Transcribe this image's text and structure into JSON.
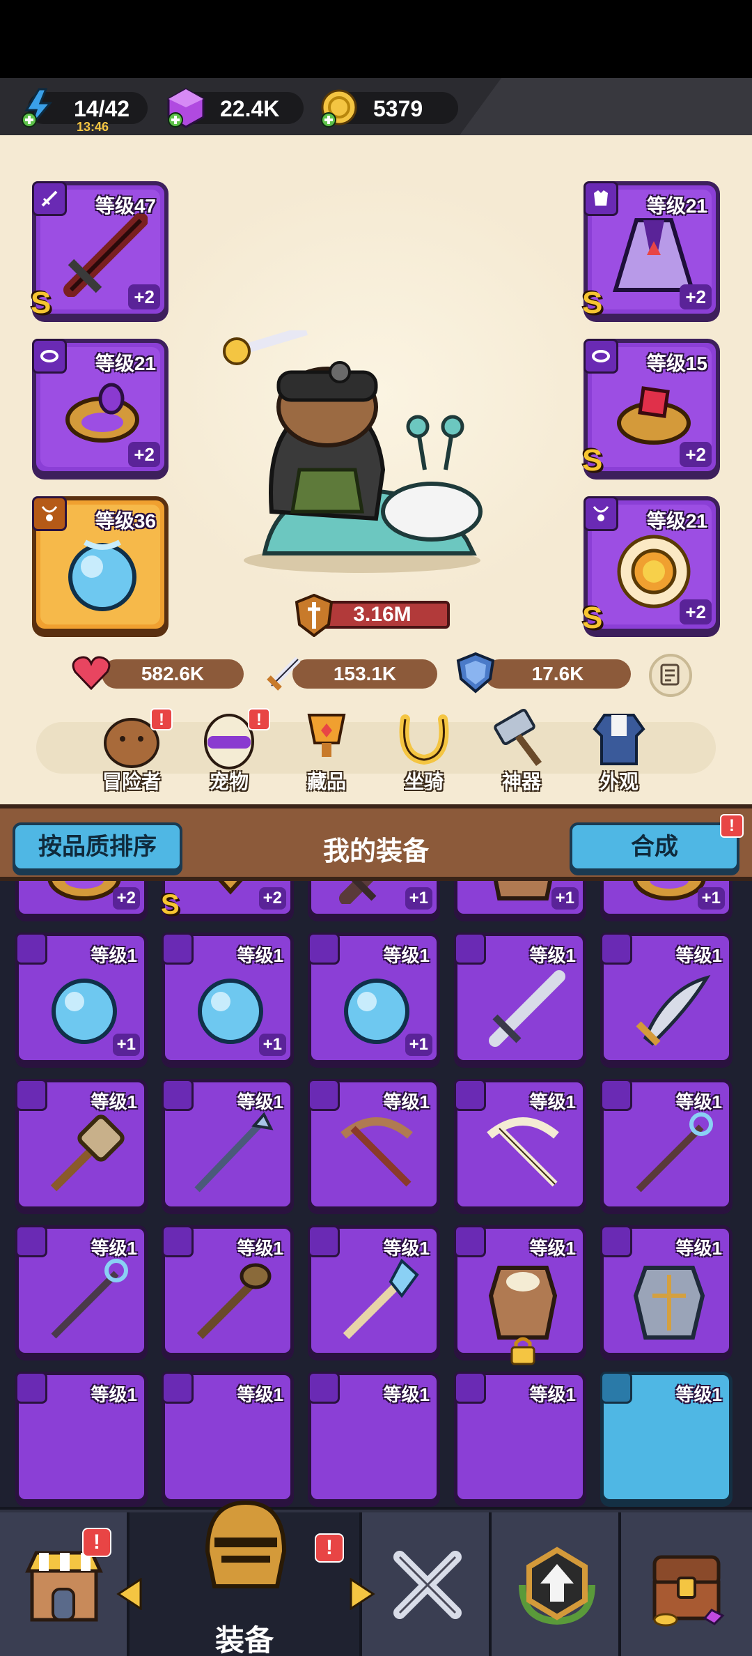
{
  "resources": {
    "energy": {
      "value": "14/42",
      "timer": "13:46",
      "icon": "lightning-icon"
    },
    "gems": {
      "value": "22.4K",
      "icon": "purple-gem-icon"
    },
    "gold": {
      "value": "5379",
      "icon": "gold-coin-icon"
    }
  },
  "hero": {
    "power": "3.16M",
    "stats": {
      "hp": "582.6K",
      "attack": "153.1K",
      "defense": "17.6K"
    }
  },
  "equipped": {
    "weapon": {
      "level": "等级47",
      "plus": "+2",
      "grade": "S"
    },
    "ring_left": {
      "level": "等级21",
      "plus": "+2"
    },
    "necklace": {
      "level": "等级36"
    },
    "armor": {
      "level": "等级21",
      "plus": "+2",
      "grade": "S"
    },
    "ring_right": {
      "level": "等级15",
      "plus": "+2",
      "grade": "S"
    },
    "amulet": {
      "level": "等级21",
      "plus": "+2",
      "grade": "S"
    }
  },
  "tabs": [
    {
      "label": "冒险者",
      "alert": "!"
    },
    {
      "label": "宠物",
      "alert": "!"
    },
    {
      "label": "藏品"
    },
    {
      "label": "坐骑"
    },
    {
      "label": "神器"
    },
    {
      "label": "外观"
    }
  ],
  "equipment_header": {
    "sort_button": "按品质排序",
    "title": "我的装备",
    "merge_button": "合成",
    "merge_alert": "!"
  },
  "inventory": {
    "row0": [
      {
        "plus": "+2"
      },
      {
        "plus": "+2",
        "grade": "S"
      },
      {
        "plus": "+1"
      },
      {
        "plus": "+1"
      },
      {
        "plus": "+1"
      }
    ],
    "row1": [
      {
        "level": "等级1",
        "plus": "+1"
      },
      {
        "level": "等级1",
        "plus": "+1"
      },
      {
        "level": "等级1",
        "plus": "+1"
      },
      {
        "level": "等级1"
      },
      {
        "level": "等级1"
      }
    ],
    "row2": [
      {
        "level": "等级1"
      },
      {
        "level": "等级1"
      },
      {
        "level": "等级1"
      },
      {
        "level": "等级1"
      },
      {
        "level": "等级1"
      }
    ],
    "row3": [
      {
        "level": "等级1"
      },
      {
        "level": "等级1"
      },
      {
        "level": "等级1"
      },
      {
        "level": "等级1"
      },
      {
        "level": "等级1"
      }
    ],
    "row4": [
      {
        "level": "等级1"
      },
      {
        "level": "等级1"
      },
      {
        "level": "等级1"
      },
      {
        "level": "等级1"
      },
      {
        "level": "等级1"
      }
    ]
  },
  "bottom_nav": {
    "shop_alert": "!",
    "equipment_label": "装备",
    "equipment_alert": "!"
  },
  "colors": {
    "purple_rarity": "#8b3fd6",
    "orange_rarity": "#f0a030",
    "cyan_rarity": "#4fb7e4",
    "parchment": "#f5ead3",
    "header_brown": "#8c5a3a"
  }
}
